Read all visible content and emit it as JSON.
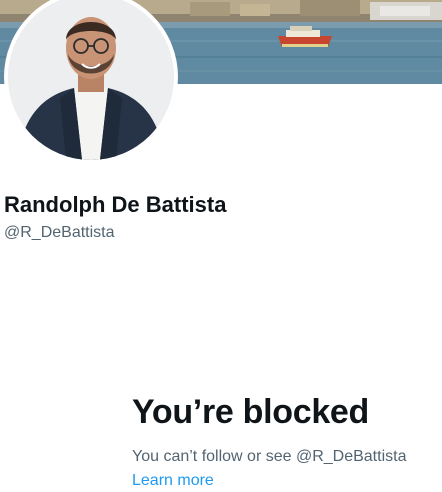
{
  "profile": {
    "display_name": "Randolph De Battista",
    "handle": "@R_DeBattista"
  },
  "blocked": {
    "title": "You’re blocked",
    "message": "You can’t follow or see @R_DeBattista",
    "learn_more": "Learn more"
  },
  "colors": {
    "text_primary": "#0f1419",
    "text_secondary": "#536471",
    "link": "#1d9bf0",
    "background": "#ffffff"
  }
}
